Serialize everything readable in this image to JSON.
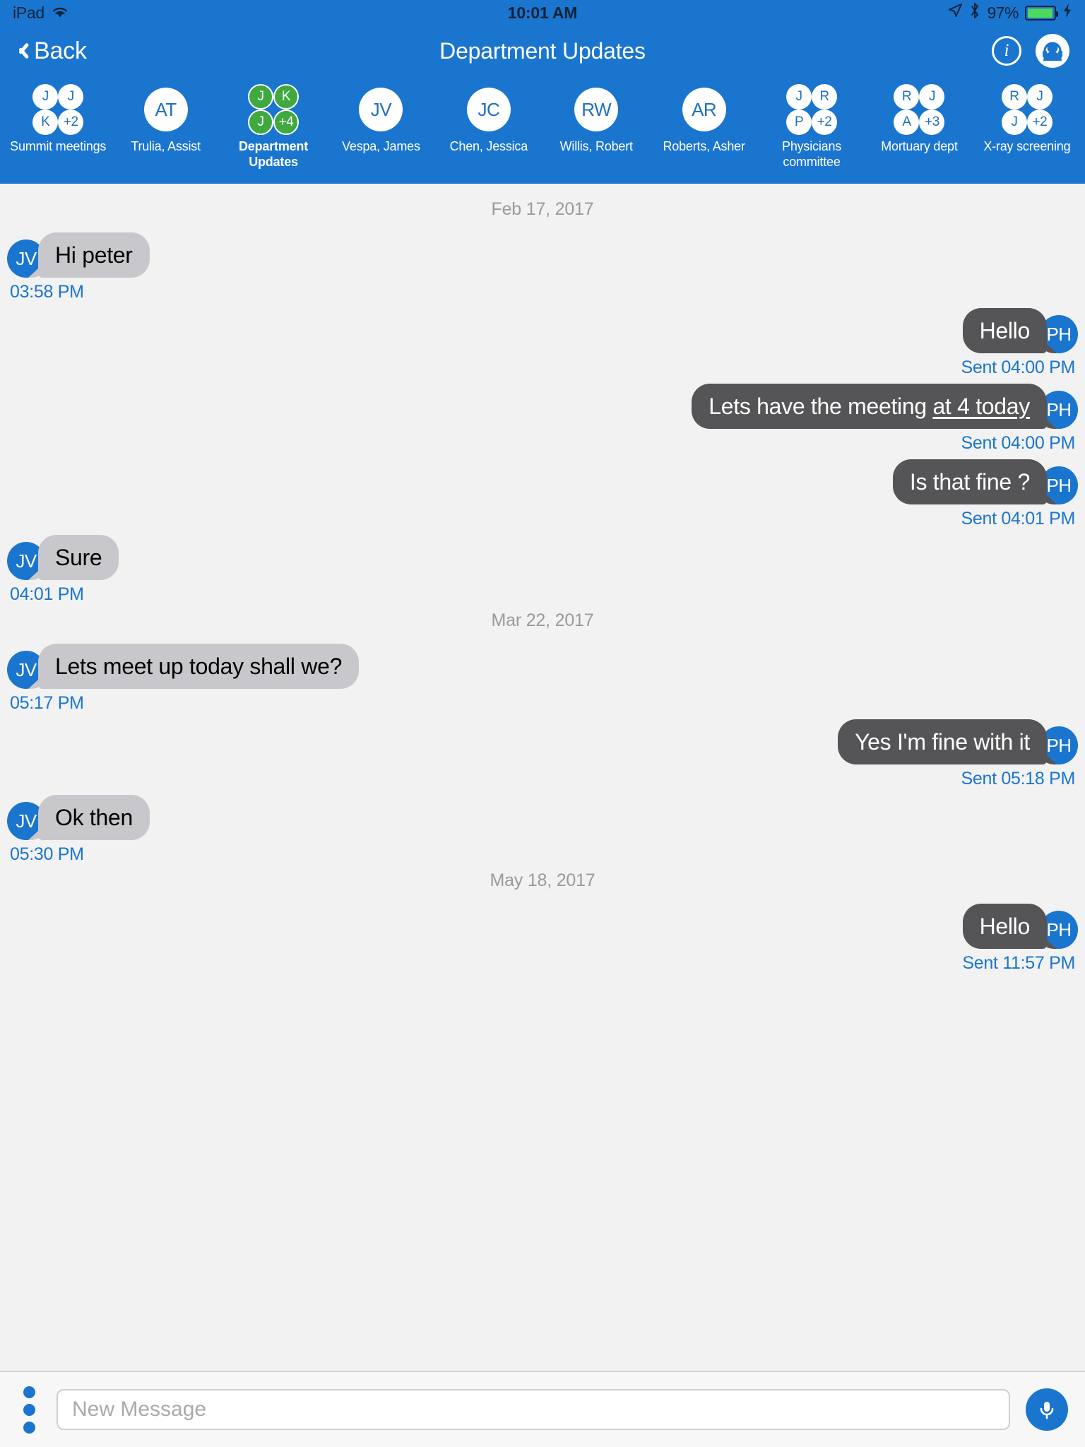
{
  "status_bar": {
    "carrier": "iPad",
    "wifi_icon": "wifi-icon",
    "time": "10:01 AM",
    "location_icon": "location-arrow-icon",
    "bluetooth_icon": "bluetooth-icon",
    "battery_percent": "97%",
    "battery_level": 97,
    "charging_icon": "lightning-bolt-icon"
  },
  "nav": {
    "back_label": "Back",
    "title": "Department Updates",
    "info_glyph": "i",
    "info_icon": "info-circle-icon",
    "agent_icon": "headset-agent-icon"
  },
  "chat_strip": {
    "items": [
      {
        "label": "Summit meetings",
        "type": "group",
        "style": "white",
        "initials": [
          "J",
          "J",
          "K",
          "+2"
        ],
        "active": false
      },
      {
        "label": "Trulia, Assist",
        "type": "single",
        "style": "white",
        "initials": [
          "AT"
        ],
        "active": false
      },
      {
        "label": "Department Updates",
        "type": "group",
        "style": "green",
        "initials": [
          "J",
          "K",
          "J",
          "+4"
        ],
        "active": true
      },
      {
        "label": "Vespa, James",
        "type": "single",
        "style": "white",
        "initials": [
          "JV"
        ],
        "active": false
      },
      {
        "label": "Chen, Jessica",
        "type": "single",
        "style": "white",
        "initials": [
          "JC"
        ],
        "active": false
      },
      {
        "label": "Willis, Robert",
        "type": "single",
        "style": "white",
        "initials": [
          "RW"
        ],
        "active": false
      },
      {
        "label": "Roberts, Asher",
        "type": "single",
        "style": "white",
        "initials": [
          "AR"
        ],
        "active": false
      },
      {
        "label": "Physicians committee",
        "type": "group",
        "style": "white",
        "initials": [
          "J",
          "R",
          "P",
          "+2"
        ],
        "active": false
      },
      {
        "label": "Mortuary dept",
        "type": "group",
        "style": "white",
        "initials": [
          "R",
          "J",
          "A",
          "+3"
        ],
        "active": false
      },
      {
        "label": "X-ray screening",
        "type": "group",
        "style": "white",
        "initials": [
          "R",
          "J",
          "J",
          "+2"
        ],
        "active": false
      }
    ]
  },
  "conversation": [
    {
      "kind": "date",
      "text": "Feb 17, 2017"
    },
    {
      "kind": "message",
      "direction": "in",
      "avatar": "JV",
      "text": "Hi peter",
      "underline": "",
      "stamp": "03:58 PM"
    },
    {
      "kind": "message",
      "direction": "out",
      "avatar": "PH",
      "text": "Hello",
      "underline": "",
      "stamp": "Sent 04:00 PM"
    },
    {
      "kind": "message",
      "direction": "out",
      "avatar": "PH",
      "text": "Lets have the meeting ",
      "underline": "at 4 today",
      "stamp": "Sent 04:00 PM"
    },
    {
      "kind": "message",
      "direction": "out",
      "avatar": "PH",
      "text": "Is that fine ?",
      "underline": "",
      "stamp": "Sent 04:01 PM"
    },
    {
      "kind": "message",
      "direction": "in",
      "avatar": "JV",
      "text": "Sure",
      "underline": "",
      "stamp": "04:01 PM"
    },
    {
      "kind": "date",
      "text": "Mar 22, 2017"
    },
    {
      "kind": "message",
      "direction": "in",
      "avatar": "JV",
      "text": "Lets meet up today shall we?",
      "underline": "",
      "stamp": "05:17 PM"
    },
    {
      "kind": "message",
      "direction": "out",
      "avatar": "PH",
      "text": "Yes I'm fine with it",
      "underline": "",
      "stamp": "Sent 05:18 PM"
    },
    {
      "kind": "message",
      "direction": "in",
      "avatar": "JV",
      "text": "Ok then",
      "underline": "",
      "stamp": "05:30 PM"
    },
    {
      "kind": "date",
      "text": "May 18, 2017"
    },
    {
      "kind": "message",
      "direction": "out",
      "avatar": "PH",
      "text": "Hello",
      "underline": "",
      "stamp": "Sent 11:57 PM"
    }
  ],
  "composer": {
    "menu_icon": "kebab-menu-icon",
    "input_value": "",
    "input_placeholder": "New Message",
    "mic_icon": "microphone-icon"
  },
  "colors": {
    "brand_blue": "#1a75cf",
    "incoming_bubble": "#c8c8cc",
    "outgoing_bubble": "#555557",
    "green_avatar": "#3fa93f",
    "timestamp_blue": "#1a75cf",
    "page_background": "#f2f2f2",
    "battery_green": "#4cd95e"
  }
}
